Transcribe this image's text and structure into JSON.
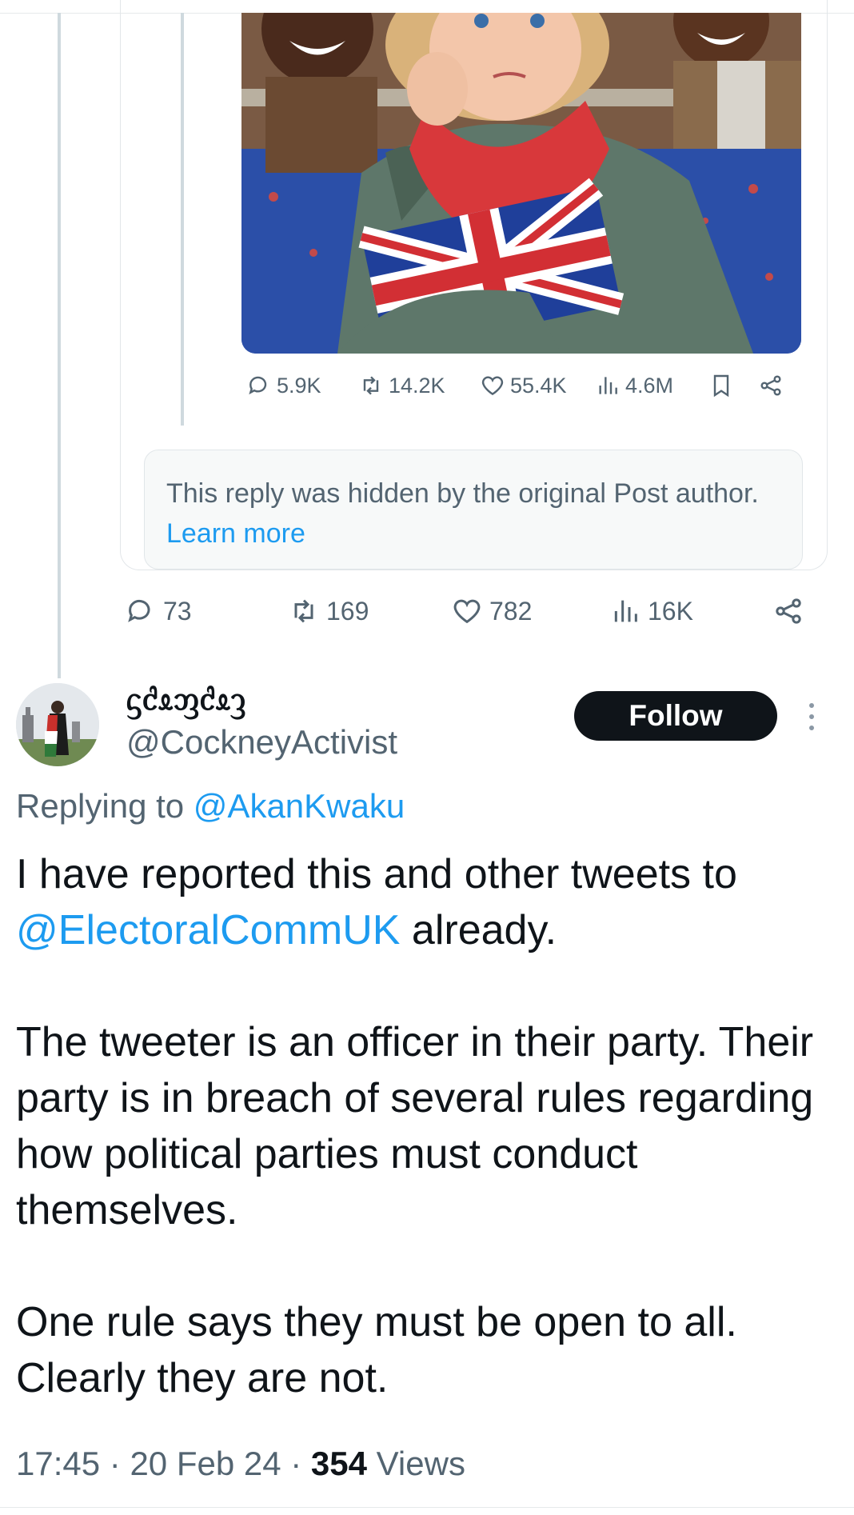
{
  "quoted_post": {
    "metrics": {
      "replies": "5.9K",
      "reposts": "14.2K",
      "likes": "55.4K",
      "views": "4.6M"
    },
    "hidden_notice": {
      "text": "This reply was hidden by the original Post author.",
      "link": "Learn more"
    }
  },
  "parent_metrics": {
    "replies": "73",
    "reposts": "169",
    "likes": "782",
    "views": "16K"
  },
  "reply": {
    "display_name": "ᦓᦺᦸᦀᦺᦸᦡ",
    "handle": "@CockneyActivist",
    "follow_label": "Follow",
    "replying_prefix": "Replying to",
    "replying_to": "@AkanKwaku",
    "line1": "I have reported this and other tweets to",
    "mention": "@ElectoralCommUK",
    "line1_end": " already.",
    "para2": "The tweeter is an officer in their party. Their party is in breach of several rules regarding how political parties must conduct themselves.",
    "para3": "One rule says they must be open to all. Clearly they are not.",
    "time": "17:45",
    "date": "20 Feb 24",
    "views_count": "354",
    "views_label": "Views"
  },
  "colors": {
    "accent": "#1d9bf0",
    "text": "#0f1419",
    "muted": "#536471"
  }
}
